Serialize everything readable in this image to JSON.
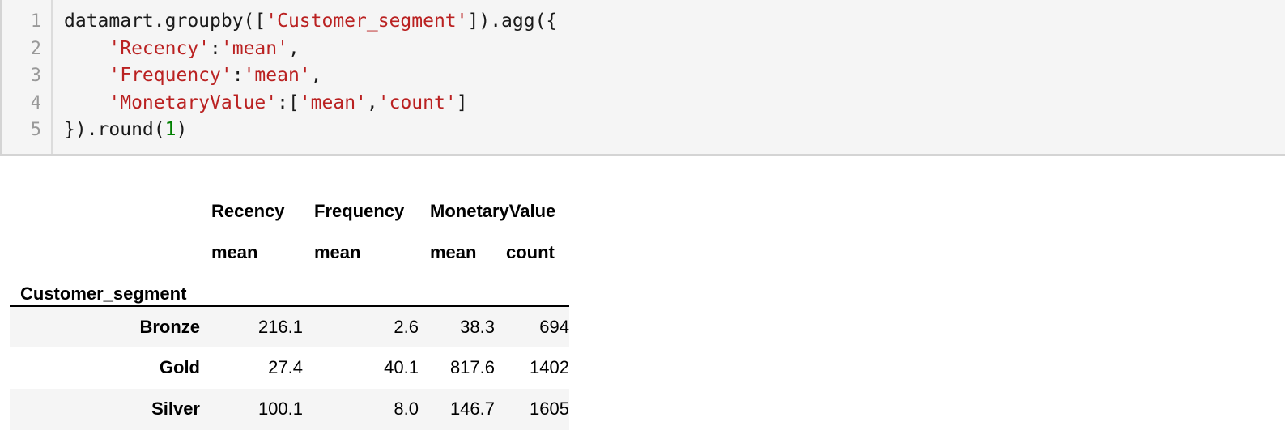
{
  "code_cell": {
    "line_numbers": [
      "1",
      "2",
      "3",
      "4",
      "5"
    ],
    "lines": [
      [
        {
          "t": "plain",
          "v": "datamart.groupby(["
        },
        {
          "t": "str",
          "v": "'Customer_segment'"
        },
        {
          "t": "plain",
          "v": "]).agg({"
        }
      ],
      [
        {
          "t": "plain",
          "v": "    "
        },
        {
          "t": "str",
          "v": "'Recency'"
        },
        {
          "t": "plain",
          "v": ":"
        },
        {
          "t": "str",
          "v": "'mean'"
        },
        {
          "t": "plain",
          "v": ","
        }
      ],
      [
        {
          "t": "plain",
          "v": "    "
        },
        {
          "t": "str",
          "v": "'Frequency'"
        },
        {
          "t": "plain",
          "v": ":"
        },
        {
          "t": "str",
          "v": "'mean'"
        },
        {
          "t": "plain",
          "v": ","
        }
      ],
      [
        {
          "t": "plain",
          "v": "    "
        },
        {
          "t": "str",
          "v": "'MonetaryValue'"
        },
        {
          "t": "plain",
          "v": ":["
        },
        {
          "t": "str",
          "v": "'mean'"
        },
        {
          "t": "plain",
          "v": ","
        },
        {
          "t": "str",
          "v": "'count'"
        },
        {
          "t": "plain",
          "v": "]"
        }
      ],
      [
        {
          "t": "plain",
          "v": "}).round("
        },
        {
          "t": "num",
          "v": "1"
        },
        {
          "t": "plain",
          "v": ")"
        }
      ]
    ],
    "colors": {
      "background": "#f5f5f5",
      "string": "#ba2121",
      "number": "#008000",
      "text": "#1a1a1a",
      "gutter_text": "#999999",
      "border": "#d4d4d4"
    }
  },
  "dataframe": {
    "column_group_headers": [
      "Recency",
      "Frequency",
      "MonetaryValue"
    ],
    "aggregation_headers": [
      "mean",
      "mean",
      "mean",
      "count"
    ],
    "index_name": "Customer_segment",
    "rows": [
      {
        "index": "Bronze",
        "values": [
          "216.1",
          "2.6",
          "38.3",
          "694"
        ]
      },
      {
        "index": "Gold",
        "values": [
          "27.4",
          "40.1",
          "817.6",
          "1402"
        ]
      },
      {
        "index": "Silver",
        "values": [
          "100.1",
          "8.0",
          "146.7",
          "1605"
        ]
      }
    ],
    "colors": {
      "row_stripe": "#f5f5f5",
      "rule": "#000000",
      "text": "#000000"
    }
  }
}
